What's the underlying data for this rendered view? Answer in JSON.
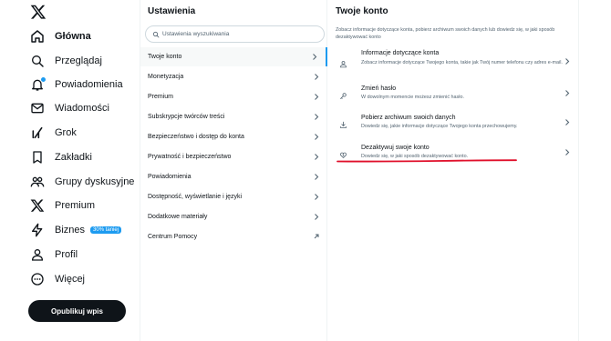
{
  "nav": {
    "items": [
      {
        "label": "Główna",
        "icon": "home-icon"
      },
      {
        "label": "Przeglądaj",
        "icon": "search-icon"
      },
      {
        "label": "Powiadomienia",
        "icon": "bell-icon"
      },
      {
        "label": "Wiadomości",
        "icon": "envelope-icon"
      },
      {
        "label": "Grok",
        "icon": "grok-icon"
      },
      {
        "label": "Zakładki",
        "icon": "bookmark-icon"
      },
      {
        "label": "Grupy dyskusyjne",
        "icon": "people-icon"
      },
      {
        "label": "Premium",
        "icon": "x-logo-icon"
      },
      {
        "label": "Biznes",
        "icon": "lightning-icon",
        "badge": "30% taniej"
      },
      {
        "label": "Profil",
        "icon": "person-icon"
      },
      {
        "label": "Więcej",
        "icon": "more-circle-icon"
      }
    ],
    "post_button": "Opublikuj wpis"
  },
  "settings": {
    "title": "Ustawienia",
    "search_placeholder": "Ustawienia wyszukiwania",
    "items": [
      {
        "label": "Twoje konto",
        "selected": true
      },
      {
        "label": "Monetyzacja"
      },
      {
        "label": "Premium"
      },
      {
        "label": "Subskrypcje twórców treści"
      },
      {
        "label": "Bezpieczeństwo i dostęp do konta"
      },
      {
        "label": "Prywatność i bezpieczeństwo"
      },
      {
        "label": "Powiadomienia"
      },
      {
        "label": "Dostępność, wyświetlanie i języki"
      },
      {
        "label": "Dodatkowe materiały"
      },
      {
        "label": "Centrum Pomocy",
        "external": true
      }
    ]
  },
  "account": {
    "title": "Twoje konto",
    "description": "Zobacz informacje dotyczące konta, pobierz archiwum swoich danych lub dowiedz się, w jaki sposób dezaktywować konto",
    "items": [
      {
        "title": "Informacje dotyczące konta",
        "subtitle": "Zobacz informacje dotyczące Twojego konta, takie jak Twój numer telefonu czy adres e-mail.",
        "icon": "person-icon"
      },
      {
        "title": "Zmień hasło",
        "subtitle": "W dowolnym momencie możesz zmienić hasło.",
        "icon": "key-icon"
      },
      {
        "title": "Pobierz archiwum swoich danych",
        "subtitle": "Dowiedz się, jakie informacje dotyczące Twojego konta przechowujemy.",
        "icon": "download-icon"
      },
      {
        "title": "Dezaktywuj swoje konto",
        "subtitle": "Dowiedz się, w jaki sposób dezaktywować konto.",
        "icon": "broken-heart-icon"
      }
    ]
  },
  "colors": {
    "accent": "#1d9bf0",
    "text": "#0f1419",
    "secondary_text": "#536471",
    "annotation": "#e0102b"
  }
}
